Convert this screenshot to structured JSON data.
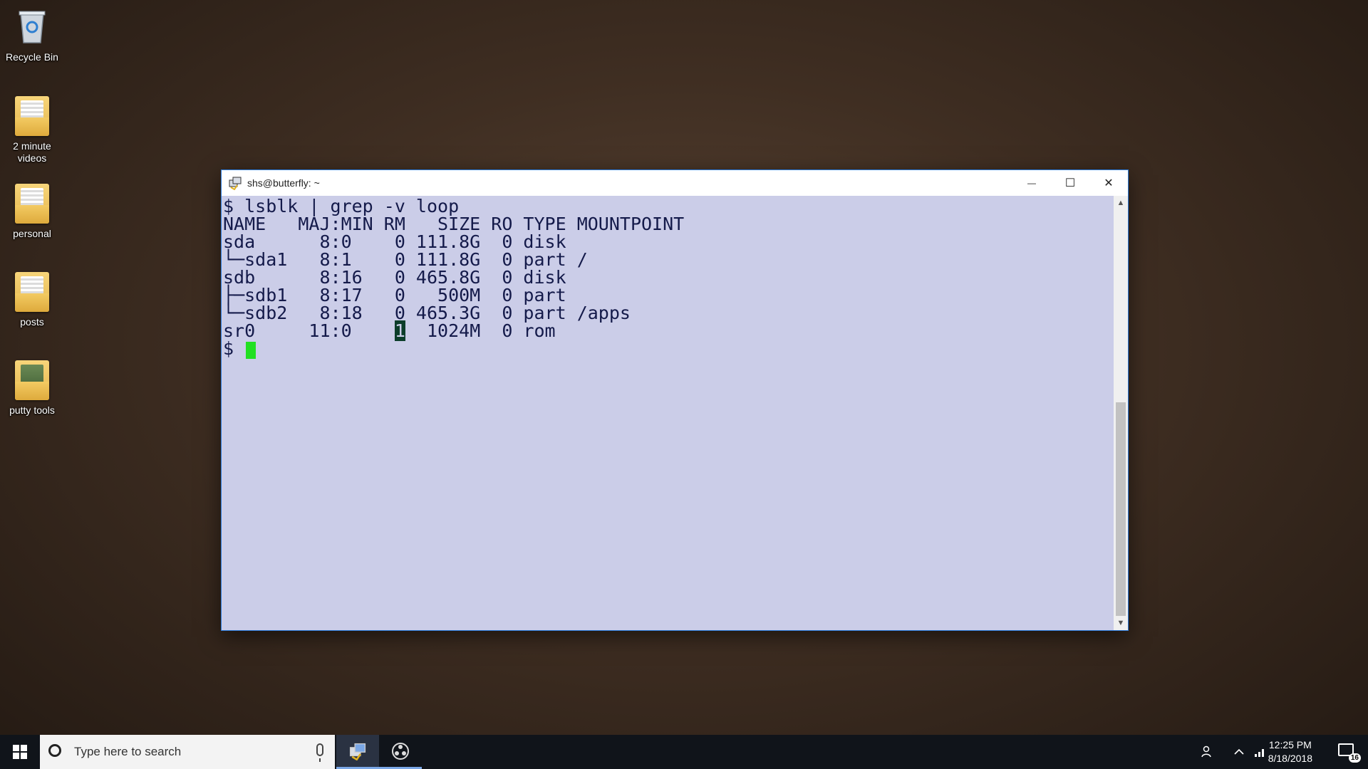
{
  "desktop": {
    "icons": [
      {
        "label": "Recycle Bin",
        "icon": "recycle-bin-icon"
      },
      {
        "label": "2 minute\nvideos",
        "icon": "folder-icon"
      },
      {
        "label": "personal",
        "icon": "folder-icon"
      },
      {
        "label": "posts",
        "icon": "folder-icon"
      },
      {
        "label": "putty tools",
        "icon": "folder-icon"
      }
    ]
  },
  "window": {
    "title": "shs@butterfly: ~",
    "controls": {
      "minimize": "—",
      "maximize": "☐",
      "close": "✕"
    },
    "accent": "#2b79d8"
  },
  "terminal": {
    "background": "#cbcde8",
    "foreground": "#141a4a",
    "cursor_color": "#22e022",
    "lines": [
      "$ lsblk | grep -v loop",
      "NAME   MAJ:MIN RM   SIZE RO TYPE MOUNTPOINT",
      "sda      8:0    0 111.8G  0 disk",
      "└─sda1   8:1    0 111.8G  0 part /",
      "sdb      8:16   0 465.8G  0 disk",
      "├─sdb1   8:17   0   500M  0 part",
      "└─sdb2   8:18   0 465.3G  0 part /apps",
      "sr0     11:0    ",
      "$ "
    ],
    "sr0_rm": "1",
    "sr0_rest": "  1024M  0 rom"
  },
  "taskbar": {
    "search_placeholder": "Type here to search",
    "time": "12:25 PM",
    "date": "8/18/2018",
    "notification_count": "16",
    "apps": [
      "putty-icon",
      "obs-icon"
    ]
  }
}
